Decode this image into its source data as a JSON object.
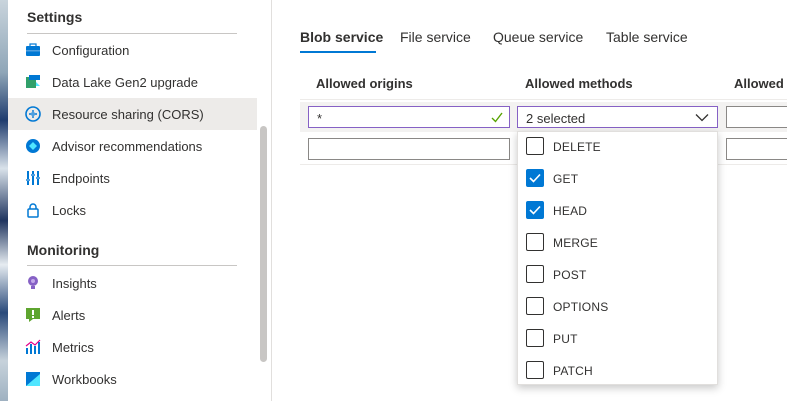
{
  "sidebar": {
    "settings_header": "Settings",
    "settings_items": [
      {
        "label": "Configuration",
        "icon": "briefcase-icon"
      },
      {
        "label": "Data Lake Gen2 upgrade",
        "icon": "upgrade-icon"
      },
      {
        "label": "Resource sharing (CORS)",
        "icon": "cors-icon",
        "active": true
      },
      {
        "label": "Advisor recommendations",
        "icon": "advisor-icon"
      },
      {
        "label": "Endpoints",
        "icon": "endpoints-icon"
      },
      {
        "label": "Locks",
        "icon": "lock-icon"
      }
    ],
    "monitoring_header": "Monitoring",
    "monitoring_items": [
      {
        "label": "Insights",
        "icon": "lightbulb-icon"
      },
      {
        "label": "Alerts",
        "icon": "alert-icon"
      },
      {
        "label": "Metrics",
        "icon": "metrics-icon"
      },
      {
        "label": "Workbooks",
        "icon": "workbook-icon"
      }
    ]
  },
  "tabs": [
    {
      "label": "Blob service",
      "active": true
    },
    {
      "label": "File service"
    },
    {
      "label": "Queue service"
    },
    {
      "label": "Table service"
    }
  ],
  "columns": {
    "allowed_origins": "Allowed origins",
    "allowed_methods": "Allowed methods",
    "allowed_headers": "Allowed h"
  },
  "row1": {
    "origin_value": "*",
    "methods_value": "2 selected"
  },
  "methods_options": [
    {
      "label": "DELETE",
      "checked": false
    },
    {
      "label": "GET",
      "checked": true
    },
    {
      "label": "HEAD",
      "checked": true
    },
    {
      "label": "MERGE",
      "checked": false
    },
    {
      "label": "POST",
      "checked": false
    },
    {
      "label": "OPTIONS",
      "checked": false
    },
    {
      "label": "PUT",
      "checked": false
    },
    {
      "label": "PATCH",
      "checked": false
    }
  ],
  "colors": {
    "accent": "#0078d4",
    "focus_border": "#8661c5",
    "valid_check": "#57a300",
    "active_nav_bg": "#edebe9"
  }
}
